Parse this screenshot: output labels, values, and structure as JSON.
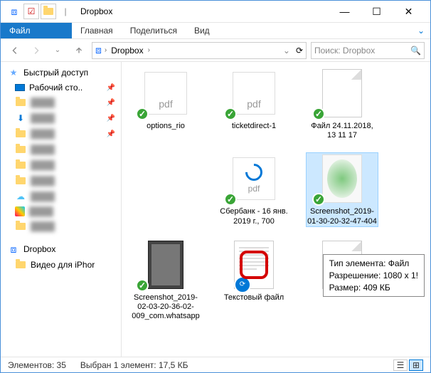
{
  "title": "Dropbox",
  "menubar": {
    "file": "Файл",
    "home": "Главная",
    "share": "Поделиться",
    "view": "Вид"
  },
  "breadcrumb": {
    "root": "Dropbox"
  },
  "search": {
    "placeholder": "Поиск: Dropbox"
  },
  "sidebar": {
    "quick": "Быстрый доступ",
    "desktop": "Рабочий сто..",
    "dropbox": "Dropbox",
    "video": "Видео для iPhor"
  },
  "files": {
    "f1": "options_rio",
    "f2": "ticketdirect-1",
    "f3": "Файл 24.11.2018, 13 11 17",
    "f4": "Сбербанк - 16 янв. 2019 г., 700",
    "f5": "Screenshot_2019-01-30-20-32-47-404",
    "f6": "Screenshot_2019-02-03-20-36-02-009_com.whatsapp",
    "f7": "Текстовый файл"
  },
  "tooltip": {
    "l1": "Тип элемента: Файл",
    "l2": "Разрешение: 1080 x 1!",
    "l3": "Размер: 409 КБ"
  },
  "status": {
    "count_label": "Элементов:",
    "count": "35",
    "sel": "Выбран 1 элемент: 17,5 КБ"
  }
}
